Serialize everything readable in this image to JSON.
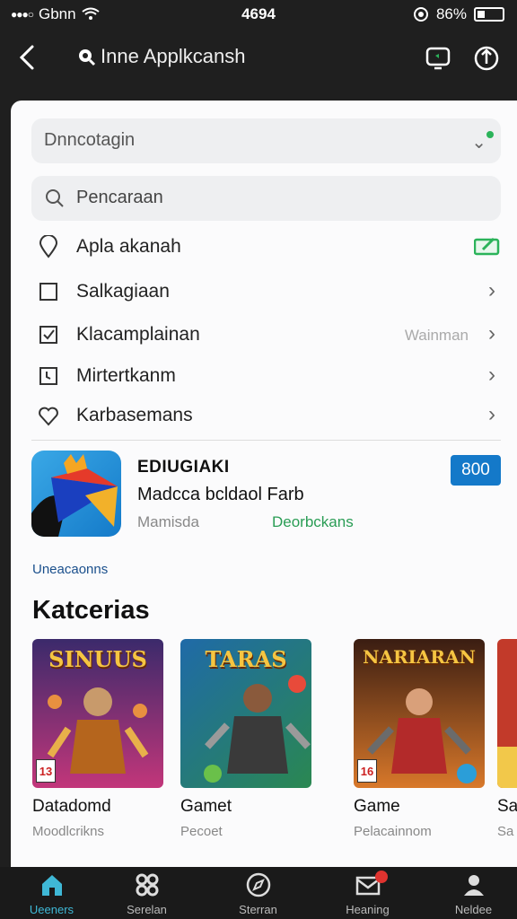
{
  "status_bar": {
    "carrier": "Gbnn",
    "time": "4694",
    "battery": "86%"
  },
  "app_bar": {
    "title": "Inne Applkcansh"
  },
  "fields": {
    "dropdown": "Dnncotagin",
    "search_placeholder": "Pencaraan"
  },
  "menu": [
    {
      "label": "Apla akanah",
      "icon": "map-pin-icon"
    },
    {
      "label": "Salkagiaan",
      "icon": "checkbox-empty-icon"
    },
    {
      "label": "Klacamplainan",
      "icon": "checkbox-checked-icon",
      "aside": "Wainman"
    },
    {
      "label": "Mirtertkanm",
      "icon": "clock-icon"
    },
    {
      "label": "Karbasemans",
      "icon": "heart-icon"
    }
  ],
  "app_card": {
    "name": "EDIUGIAKI",
    "subtitle": "Madcca bcldaol Farb",
    "developer": "Mamisda",
    "tag": "Deorbckans",
    "price": "800"
  },
  "section": {
    "link": "Uneacaonns",
    "title": "Katcerias"
  },
  "categories": [
    {
      "title": "SINUUS",
      "label": "Datadomd",
      "sub": "Moodlcrikns",
      "rating": "13"
    },
    {
      "title": "TARAS",
      "label": "Gamet",
      "sub": "Pecoet",
      "rating": ""
    },
    {
      "title": "NARIARAN",
      "label": "Game",
      "sub": "Pelacainnom",
      "rating": "16"
    },
    {
      "title": "",
      "label": "Sa",
      "sub": "Sa",
      "rating": ""
    }
  ],
  "bottom_nav": [
    {
      "label": "Ueeners",
      "icon": "home-icon",
      "active": true
    },
    {
      "label": "Serelan",
      "icon": "apps-icon"
    },
    {
      "label": "Sterran",
      "icon": "compass-icon"
    },
    {
      "label": "Heaning",
      "icon": "mail-icon"
    },
    {
      "label": "Neldee",
      "icon": "profile-icon"
    }
  ],
  "colors": {
    "accent": "#1479c9",
    "green": "#2a9d55",
    "dark": "#1f1f1f"
  }
}
